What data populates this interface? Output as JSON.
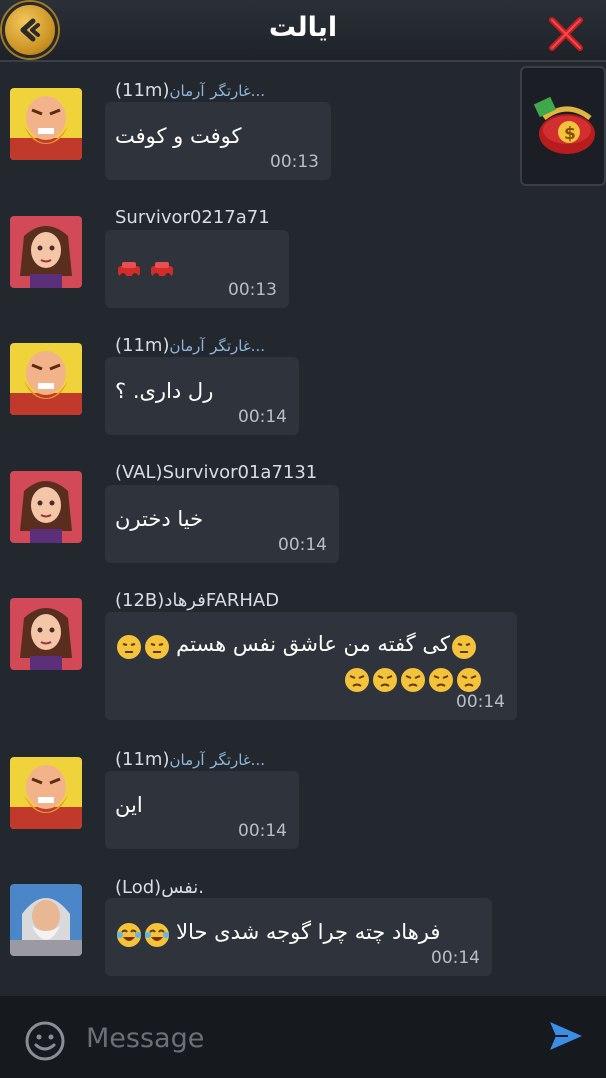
{
  "header": {
    "title": "ایالت",
    "back_icon": "back-arrow-icon",
    "close_icon": "close-x-icon"
  },
  "wallet": {
    "icon": "money-purse-icon"
  },
  "messages": [
    {
      "avatar": "avatar-bearded-warrior",
      "sender_tag": "(11m)",
      "sender_guild": "غارتگر",
      "sender_name": "آرمان...",
      "text": "کوفت و کوفت",
      "time": "00:13"
    },
    {
      "avatar": "avatar-female-elf",
      "sender_tag": "",
      "sender_guild": "",
      "sender_name": "Survivor0217a71",
      "text": "",
      "emoji": [
        "car-icon",
        "car-icon"
      ],
      "time": "00:13"
    },
    {
      "avatar": "avatar-bearded-warrior",
      "sender_tag": "(11m)",
      "sender_guild": "غارتگر",
      "sender_name": "آرمان...",
      "text": "رل داری. ؟",
      "time": "00:14"
    },
    {
      "avatar": "avatar-female-elf",
      "sender_tag": "(VAL)",
      "sender_guild": "",
      "sender_name": "Survivor01a7131",
      "text": "خیا دخترن",
      "time": "00:14"
    },
    {
      "avatar": "avatar-female-elf",
      "sender_tag": "(12B)",
      "sender_guild": "",
      "sender_name": "فرهادFARHAD",
      "text": "کی گفته من عاشق نفس هستم",
      "time": "00:14"
    },
    {
      "avatar": "avatar-bearded-warrior",
      "sender_tag": "(11m)",
      "sender_guild": "غارتگر",
      "sender_name": "آرمان...",
      "text": "این",
      "time": "00:14"
    },
    {
      "avatar": "avatar-white-bearded-elder",
      "sender_tag": "(Lod)",
      "sender_guild": "",
      "sender_name": "نفس.",
      "text": "فرهاد چته چرا گوجه شدی حالا",
      "time": "00:14"
    }
  ],
  "input": {
    "placeholder": "Message",
    "emoji_icon": "smiley-icon",
    "send_icon": "send-arrow-icon"
  },
  "colors": {
    "background": "#23282f",
    "bubble": "#2f343c",
    "guild_blue": "#8fb6d9",
    "send_blue": "#3a8ee6",
    "close_red": "#d6282b"
  }
}
